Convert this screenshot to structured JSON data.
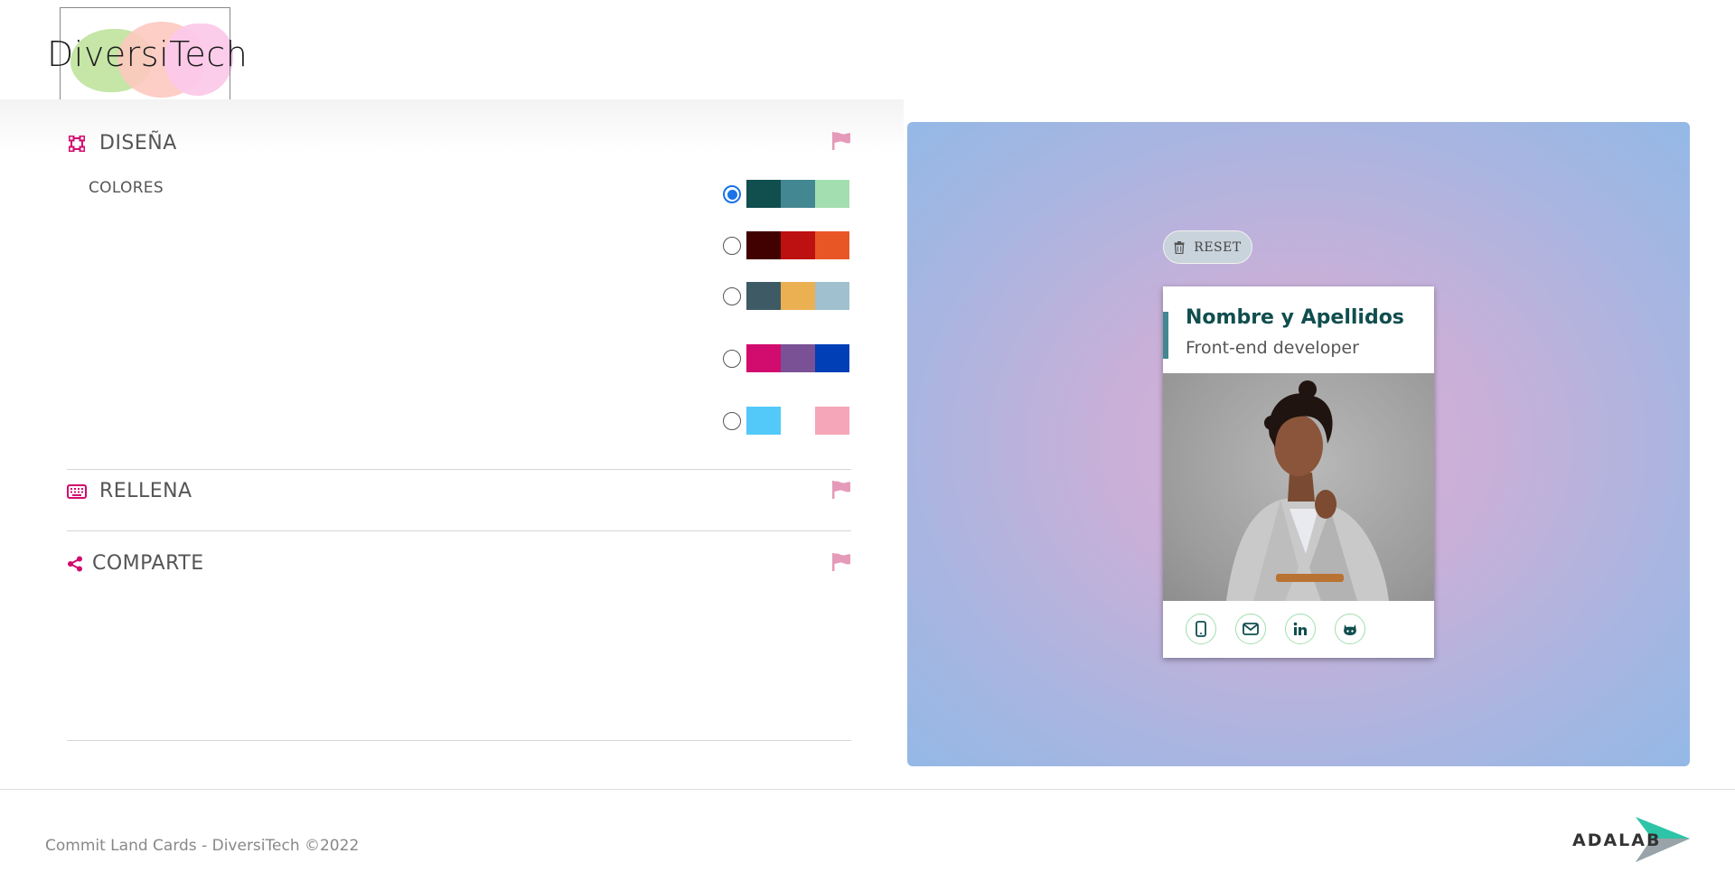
{
  "header": {
    "logo_text": "DiversiTech"
  },
  "design": {
    "title": "DISEÑA",
    "colors_label": "COLORES",
    "palettes": [
      {
        "checked": true,
        "colors": [
          "#114e4e",
          "#438792",
          "#a2deaf"
        ]
      },
      {
        "checked": false,
        "colors": [
          "#420101",
          "#bd1010",
          "#e95626"
        ]
      },
      {
        "checked": false,
        "colors": [
          "#3e5b65",
          "#eab052",
          "#a0c0cf"
        ]
      },
      {
        "checked": false,
        "colors": [
          "#d20b6e",
          "#7a5195",
          "#003fb6"
        ]
      },
      {
        "checked": false,
        "colors": [
          "#53c9fa",
          "#ffffff",
          "#f5a6b9"
        ]
      }
    ]
  },
  "fill": {
    "title": "RELLENA"
  },
  "share": {
    "title": "COMPARTE"
  },
  "preview": {
    "reset_label": "RESET",
    "card": {
      "name": "Nombre y Apellidos",
      "job": "Front-end developer",
      "social_icons": [
        "phone-icon",
        "mail-icon",
        "linkedin-icon",
        "github-icon"
      ]
    }
  },
  "colors": {
    "accent": "#d20b6e",
    "flag": "#e59ab9"
  },
  "footer": {
    "copyright": "Commit Land Cards - DiversiTech ©2022",
    "brand": "ADALAB"
  }
}
